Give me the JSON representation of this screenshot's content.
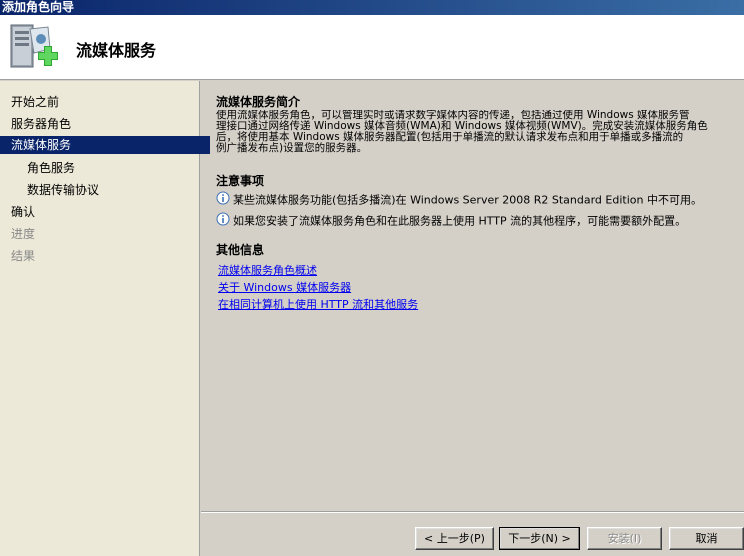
{
  "window": {
    "title": "添加角色向导"
  },
  "header": {
    "title": "流媒体服务",
    "icon": "server-role-add-icon"
  },
  "nav": {
    "items": [
      {
        "label": "开始之前",
        "state": "normal"
      },
      {
        "label": "服务器角色",
        "state": "normal"
      },
      {
        "label": "流媒体服务",
        "state": "active"
      },
      {
        "label": "角色服务",
        "state": "normal"
      },
      {
        "label": "数据传输协议",
        "state": "normal"
      },
      {
        "label": "确认",
        "state": "normal"
      },
      {
        "label": "进度",
        "state": "disabled"
      },
      {
        "label": "结果",
        "state": "disabled"
      }
    ]
  },
  "content": {
    "intro_title": "流媒体服务简介",
    "intro_text": "使用流媒体服务角色，可以管理实时或请求数字媒体内容的传递，包括通过使用 Windows 媒体服务管\n理接口通过网络传递 Windows 媒体音频(WMA)和 Windows 媒体视频(WMV)。完成安装流媒体服务角色\n后，将使用基本 Windows 媒体服务器配置(包括用于单播流的默认请求发布点和用于单播或多播流的\n例广播发布点)设置您的服务器。",
    "notes_title": "注意事项",
    "notes": [
      "某些流媒体服务功能(包括多播流)在 Windows Server 2008 R2 Standard Edition 中不可用。",
      "如果您安装了流媒体服务角色和在此服务器上使用 HTTP 流的其他程序，可能需要额外配置。"
    ],
    "more_title": "其他信息",
    "links": [
      "流媒体服务角色概述",
      "关于 Windows 媒体服务器",
      "在相同计算机上使用 HTTP 流和其他服务"
    ]
  },
  "buttons": {
    "prev": "< 上一步(P)",
    "next": "下一步(N) >",
    "install": "安装(I)",
    "cancel": "取消"
  }
}
